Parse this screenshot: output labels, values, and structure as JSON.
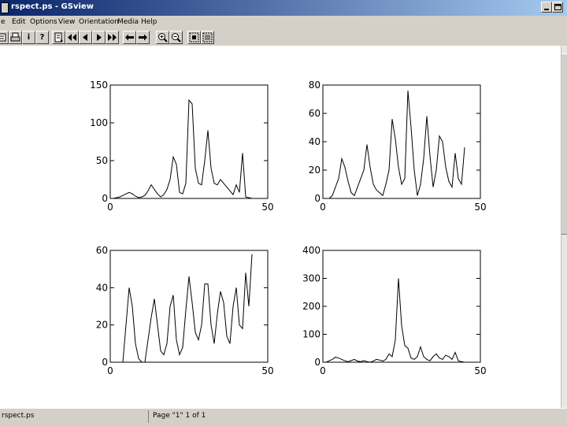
{
  "window": {
    "title": "rspect.ps - GSview"
  },
  "menu": {
    "items": [
      "e",
      "Edit",
      "Options",
      "View",
      "Orientation",
      "Media",
      "Help"
    ]
  },
  "toolbar": {
    "buttons": [
      {
        "name": "open-icon"
      },
      {
        "name": "print-icon"
      },
      {
        "name": "info-icon",
        "label": "i"
      },
      {
        "name": "help-icon",
        "label": "?"
      },
      {
        "name": "goto-page-icon"
      },
      {
        "name": "first-page-icon"
      },
      {
        "name": "prev-page-icon"
      },
      {
        "name": "next-page-icon"
      },
      {
        "name": "last-page-icon"
      },
      {
        "name": "back-icon"
      },
      {
        "name": "forward-icon"
      },
      {
        "name": "zoom-in-icon"
      },
      {
        "name": "zoom-out-icon"
      },
      {
        "name": "epsf-icon"
      },
      {
        "name": "fullscreen-icon"
      }
    ]
  },
  "status": {
    "file": "rspect.ps",
    "page": "Page \"1\" 1 of 1"
  },
  "chart_data": [
    {
      "type": "line",
      "xlim": [
        0,
        50
      ],
      "ylim": [
        0,
        150
      ],
      "xticks": [
        0,
        50
      ],
      "yticks": [
        0,
        50,
        100,
        150
      ],
      "x": [
        1,
        2,
        3,
        4,
        5,
        6,
        7,
        8,
        9,
        10,
        11,
        12,
        13,
        14,
        15,
        16,
        17,
        18,
        19,
        20,
        21,
        22,
        23,
        24,
        25,
        26,
        27,
        28,
        29,
        30,
        31,
        32,
        33,
        34,
        35,
        36,
        37,
        38,
        39,
        40,
        41,
        42,
        43,
        44,
        45
      ],
      "values": [
        0,
        1,
        2,
        4,
        6,
        8,
        6,
        3,
        1,
        2,
        4,
        10,
        18,
        12,
        6,
        2,
        5,
        12,
        25,
        55,
        45,
        8,
        6,
        20,
        130,
        125,
        40,
        20,
        18,
        50,
        90,
        40,
        20,
        18,
        25,
        20,
        15,
        10,
        5,
        18,
        8,
        60,
        2,
        1,
        0
      ]
    },
    {
      "type": "line",
      "xlim": [
        0,
        50
      ],
      "ylim": [
        0,
        80
      ],
      "xticks": [
        0,
        50
      ],
      "yticks": [
        0,
        20,
        40,
        60,
        80
      ],
      "x": [
        1,
        2,
        3,
        4,
        5,
        6,
        7,
        8,
        9,
        10,
        11,
        12,
        13,
        14,
        15,
        16,
        17,
        18,
        19,
        20,
        21,
        22,
        23,
        24,
        25,
        26,
        27,
        28,
        29,
        30,
        31,
        32,
        33,
        34,
        35,
        36,
        37,
        38,
        39,
        40,
        41,
        42,
        43,
        44,
        45
      ],
      "values": [
        0,
        0,
        2,
        8,
        14,
        28,
        22,
        12,
        4,
        2,
        8,
        14,
        20,
        38,
        22,
        10,
        6,
        4,
        2,
        10,
        20,
        56,
        42,
        22,
        10,
        14,
        76,
        50,
        20,
        2,
        10,
        28,
        58,
        30,
        8,
        20,
        44,
        40,
        22,
        12,
        8,
        32,
        14,
        10,
        36
      ]
    },
    {
      "type": "line",
      "xlim": [
        0,
        50
      ],
      "ylim": [
        0,
        60
      ],
      "xticks": [
        0,
        50
      ],
      "yticks": [
        0,
        20,
        40,
        60
      ],
      "x": [
        1,
        2,
        3,
        4,
        5,
        6,
        7,
        8,
        9,
        10,
        11,
        12,
        13,
        14,
        15,
        16,
        17,
        18,
        19,
        20,
        21,
        22,
        23,
        24,
        25,
        26,
        27,
        28,
        29,
        30,
        31,
        32,
        33,
        34,
        35,
        36,
        37,
        38,
        39,
        40,
        41,
        42,
        43,
        44,
        45
      ],
      "values": [
        0,
        0,
        0,
        0,
        20,
        40,
        30,
        10,
        2,
        0,
        0,
        12,
        24,
        34,
        20,
        6,
        4,
        10,
        30,
        36,
        12,
        4,
        8,
        28,
        46,
        32,
        16,
        12,
        20,
        42,
        42,
        20,
        10,
        26,
        38,
        32,
        14,
        10,
        30,
        40,
        20,
        18,
        48,
        30,
        58
      ]
    },
    {
      "type": "line",
      "xlim": [
        0,
        50
      ],
      "ylim": [
        0,
        400
      ],
      "xticks": [
        0,
        50
      ],
      "yticks": [
        0,
        100,
        200,
        300,
        400
      ],
      "x": [
        1,
        2,
        3,
        4,
        5,
        6,
        7,
        8,
        9,
        10,
        11,
        12,
        13,
        14,
        15,
        16,
        17,
        18,
        19,
        20,
        21,
        22,
        23,
        24,
        25,
        26,
        27,
        28,
        29,
        30,
        31,
        32,
        33,
        34,
        35,
        36,
        37,
        38,
        39,
        40,
        41,
        42,
        43,
        44,
        45
      ],
      "values": [
        0,
        5,
        10,
        18,
        15,
        10,
        5,
        2,
        6,
        10,
        4,
        2,
        6,
        2,
        0,
        4,
        10,
        8,
        4,
        10,
        30,
        20,
        80,
        300,
        130,
        60,
        50,
        15,
        10,
        20,
        55,
        20,
        10,
        5,
        20,
        30,
        15,
        10,
        25,
        20,
        10,
        35,
        5,
        2,
        0
      ]
    }
  ]
}
